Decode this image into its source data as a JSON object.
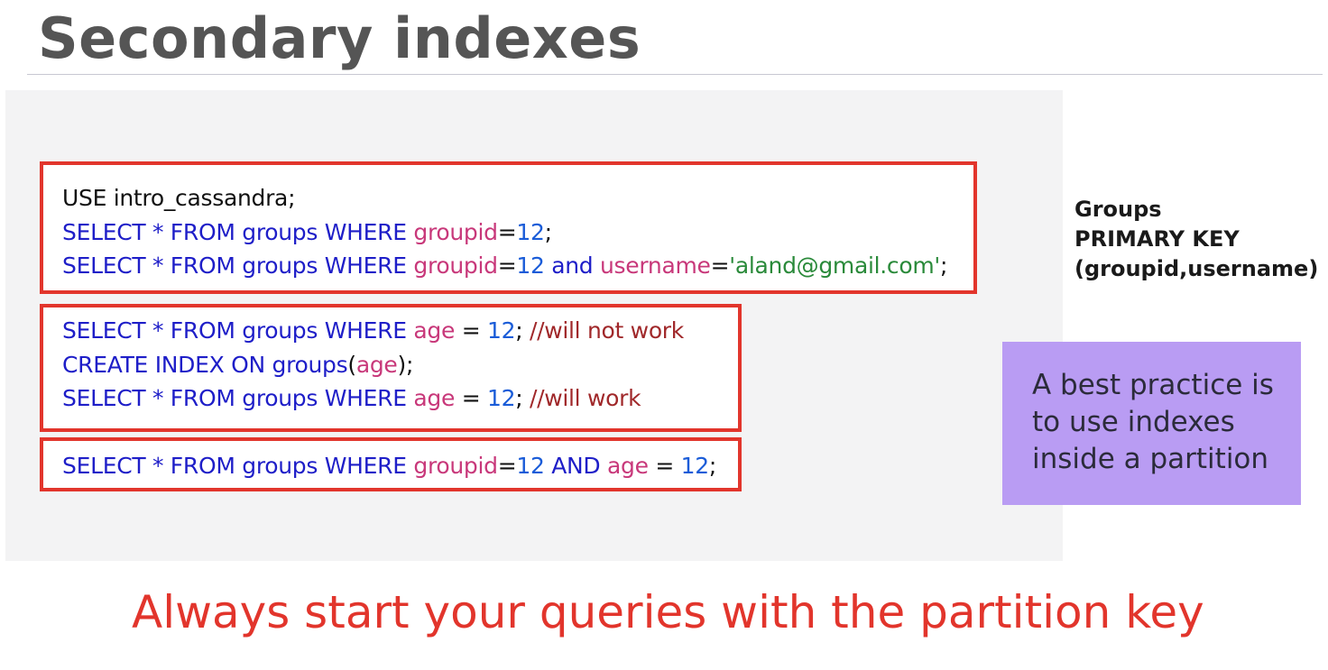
{
  "title": "Secondary indexes",
  "box1": {
    "line1": [
      {
        "t": "USE intro_cassandra;",
        "c": "plain"
      }
    ],
    "line2": [
      {
        "t": "SELECT * FROM groups WHERE ",
        "c": "kw"
      },
      {
        "t": "groupid",
        "c": "col"
      },
      {
        "t": "=",
        "c": "plain"
      },
      {
        "t": "12",
        "c": "num"
      },
      {
        "t": ";",
        "c": "plain"
      }
    ],
    "line3": [
      {
        "t": "SELECT * FROM groups WHERE ",
        "c": "kw"
      },
      {
        "t": "groupid",
        "c": "col"
      },
      {
        "t": "=",
        "c": "plain"
      },
      {
        "t": "12",
        "c": "num"
      },
      {
        "t": " and ",
        "c": "kw"
      },
      {
        "t": "username",
        "c": "col"
      },
      {
        "t": "=",
        "c": "plain"
      },
      {
        "t": "'aland@gmail.com'",
        "c": "str"
      },
      {
        "t": ";",
        "c": "plain"
      }
    ]
  },
  "box2": {
    "line1": [
      {
        "t": "SELECT * FROM groups WHERE ",
        "c": "kw"
      },
      {
        "t": "age",
        "c": "col"
      },
      {
        "t": " = ",
        "c": "plain"
      },
      {
        "t": "12",
        "c": "num"
      },
      {
        "t": "; ",
        "c": "plain"
      },
      {
        "t": "//will not work",
        "c": "cmt"
      }
    ],
    "line2": [
      {
        "t": "CREATE INDEX ON groups",
        "c": "kw"
      },
      {
        "t": "(",
        "c": "plain"
      },
      {
        "t": "age",
        "c": "col"
      },
      {
        "t": ");",
        "c": "plain"
      }
    ],
    "line3": [
      {
        "t": "SELECT * FROM groups WHERE ",
        "c": "kw"
      },
      {
        "t": "age",
        "c": "col"
      },
      {
        "t": " = ",
        "c": "plain"
      },
      {
        "t": "12",
        "c": "num"
      },
      {
        "t": "; ",
        "c": "plain"
      },
      {
        "t": "//will work",
        "c": "cmt"
      }
    ]
  },
  "box3": {
    "line1": [
      {
        "t": "SELECT * FROM groups WHERE ",
        "c": "kw"
      },
      {
        "t": "groupid",
        "c": "col"
      },
      {
        "t": "=",
        "c": "plain"
      },
      {
        "t": "12",
        "c": "num"
      },
      {
        "t": " AND ",
        "c": "kw"
      },
      {
        "t": "age",
        "c": "col"
      },
      {
        "t": " = ",
        "c": "plain"
      },
      {
        "t": "12",
        "c": "num"
      },
      {
        "t": ";",
        "c": "plain"
      }
    ]
  },
  "groups_info": {
    "line1": "Groups",
    "line2": "PRIMARY KEY",
    "line3": "(groupid,username)"
  },
  "tip": {
    "line1": "A best practice is",
    "line2": "to use indexes",
    "line3": "inside a partition"
  },
  "footer": "Always start your queries with the partition key",
  "colors": {
    "border": "#e2352c",
    "keyword": "#1e1ec8",
    "column": "#c8387a",
    "number": "#1a5cd8",
    "string": "#2a8a3a",
    "comment": "#a0282a",
    "tip_bg": "#b99cf3"
  }
}
